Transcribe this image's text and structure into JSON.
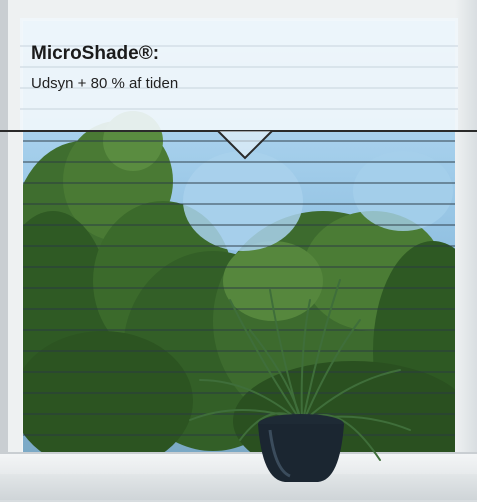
{
  "label": {
    "title": "MicroShade®:",
    "subtitle": "Udsyn + 80 % af tiden"
  },
  "colors": {
    "sky": "#9fcbe9",
    "foliage": "#3d6b2e",
    "frame": "#eef1f2",
    "label_bg": "#f0f6fb",
    "slat_line": "#2b3a44"
  }
}
